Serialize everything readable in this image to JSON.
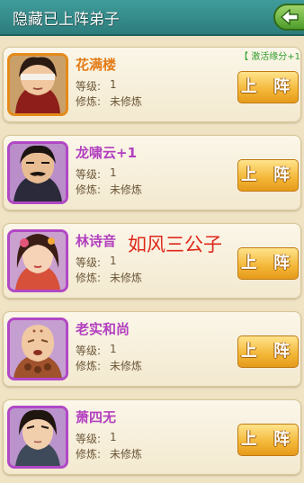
{
  "header": {
    "title": "隐藏已上阵弟子",
    "back_icon": "arrow-left-icon"
  },
  "labels": {
    "level": "等级:",
    "cultivation": "修炼:"
  },
  "bonus_text": "【 激活缘分+1",
  "overlay_text": "如风三公子",
  "deploy_label": "上 阵",
  "disciples": [
    {
      "name": "花满楼",
      "level": "1",
      "cultivation": "未修炼",
      "rarity_color": "#e38a1b"
    },
    {
      "name": "龙啸云+1",
      "level": "1",
      "cultivation": "未修炼",
      "rarity_color": "#b148c5"
    },
    {
      "name": "林诗音",
      "level": "1",
      "cultivation": "未修炼",
      "rarity_color": "#b148c5"
    },
    {
      "name": "老实和尚",
      "level": "1",
      "cultivation": "未修炼",
      "rarity_color": "#b148c5"
    },
    {
      "name": "萧四无",
      "level": "1",
      "cultivation": "未修炼",
      "rarity_color": "#b148c5"
    }
  ]
}
